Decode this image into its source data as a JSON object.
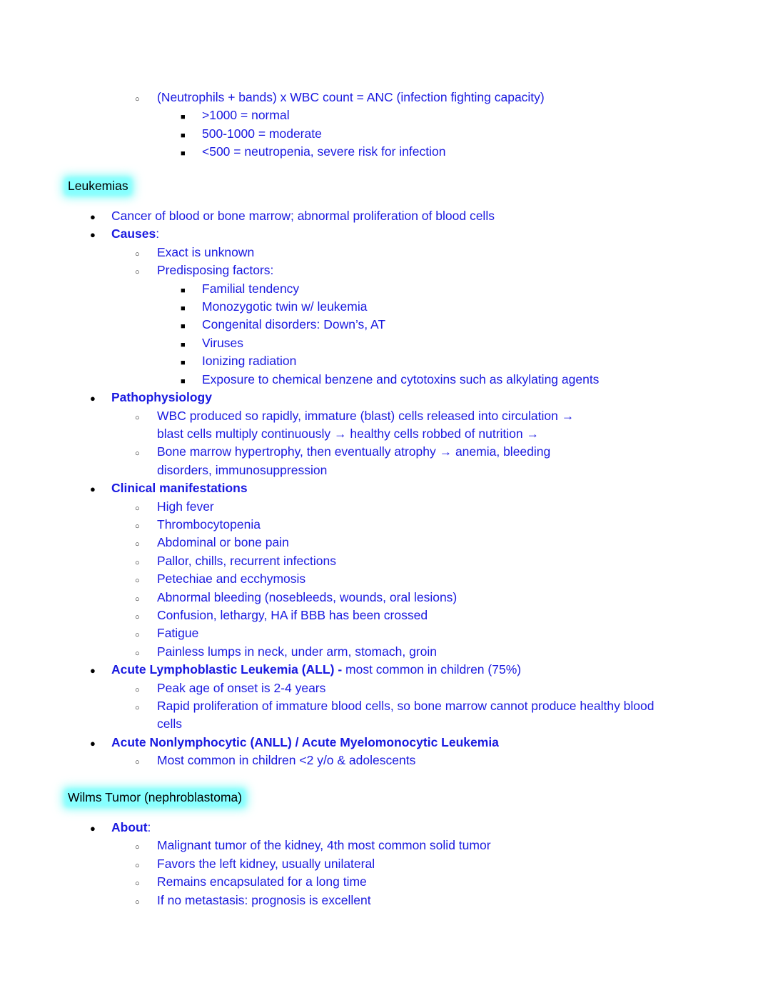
{
  "document": {
    "top_list": {
      "level2_item": "(Neutrophils + bands) x WBC count = ANC (infection fighting capacity)",
      "level3_items": [
        ">1000 = normal",
        "500-1000 = moderate",
        "<500 = neutropenia, severe risk for infection"
      ]
    },
    "sections": [
      {
        "header": "Leukemias",
        "header_highlight_color": "#7dfcf7",
        "items": [
          {
            "text": "Cancer of blood or bone marrow; abnormal proliferation of blood cells"
          },
          {
            "bold_text": "Causes",
            "plain_text": ":",
            "children": [
              {
                "text": "Exact is unknown"
              },
              {
                "text": "Predisposing factors:",
                "children": [
                  {
                    "text": "Familial tendency"
                  },
                  {
                    "text": "Monozygotic twin w/ leukemia"
                  },
                  {
                    "text": "Congenital disorders: Down’s, AT"
                  },
                  {
                    "text": "Viruses"
                  },
                  {
                    "text": "Ionizing radiation"
                  },
                  {
                    "text": "Exposure to chemical benzene and cytotoxins such as alkylating agents"
                  }
                ]
              }
            ]
          },
          {
            "bold_text": "Pathophysiology",
            "plain_text": "",
            "children": [
              {
                "text": "WBC produced so rapidly, immature (blast) cells released into circulation → blast cells multiply continuously → healthy cells robbed of nutrition →"
              },
              {
                "text": "Bone marrow hypertrophy, then eventually atrophy → anemia, bleeding disorders, immunosuppression"
              }
            ]
          },
          {
            "bold_text": "Clinical manifestations",
            "plain_text": "",
            "children": [
              {
                "text": "High fever"
              },
              {
                "text": "Thrombocytopenia"
              },
              {
                "text": "Abdominal or bone pain"
              },
              {
                "text": "Pallor, chills, recurrent infections"
              },
              {
                "text": "Petechiae and ecchymosis"
              },
              {
                "text": "Abnormal bleeding (nosebleeds, wounds, oral lesions)"
              },
              {
                "text": "Confusion, lethargy, HA if BBB has been crossed"
              },
              {
                "text": "Fatigue"
              },
              {
                "text": "Painless lumps in neck, under arm, stomach, groin"
              }
            ]
          },
          {
            "bold_text": "Acute Lymphoblastic Leukemia (ALL) -",
            "plain_text": " most common in children (75%)",
            "children": [
              {
                "text": "Peak age of onset is 2-4 years"
              },
              {
                "text": "Rapid proliferation of immature blood cells, so bone marrow cannot produce healthy blood cells"
              }
            ]
          },
          {
            "bold_text": "Acute Nonlymphocytic (ANLL) / Acute Myelomonocytic Leukemia",
            "plain_text": "",
            "children": [
              {
                "text": "Most common in children <2 y/o & adolescents"
              }
            ]
          }
        ]
      },
      {
        "header": "Wilms Tumor (nephroblastoma)",
        "header_highlight_color": "#7dfcf7",
        "items": [
          {
            "bold_text": "About",
            "plain_text": ":",
            "children": [
              {
                "text": "Malignant tumor of the kidney, 4th most common solid tumor"
              },
              {
                "text": "Favors the left kidney, usually unilateral"
              },
              {
                "text": "Remains encapsulated for a long time"
              },
              {
                "text": "If no metastasis: prognosis is excellent"
              }
            ]
          }
        ]
      }
    ],
    "colors": {
      "body_text": "#1a1ae0",
      "header_text": "#000000",
      "highlight": "#7dfcf7",
      "page_background": "#ffffff"
    }
  }
}
